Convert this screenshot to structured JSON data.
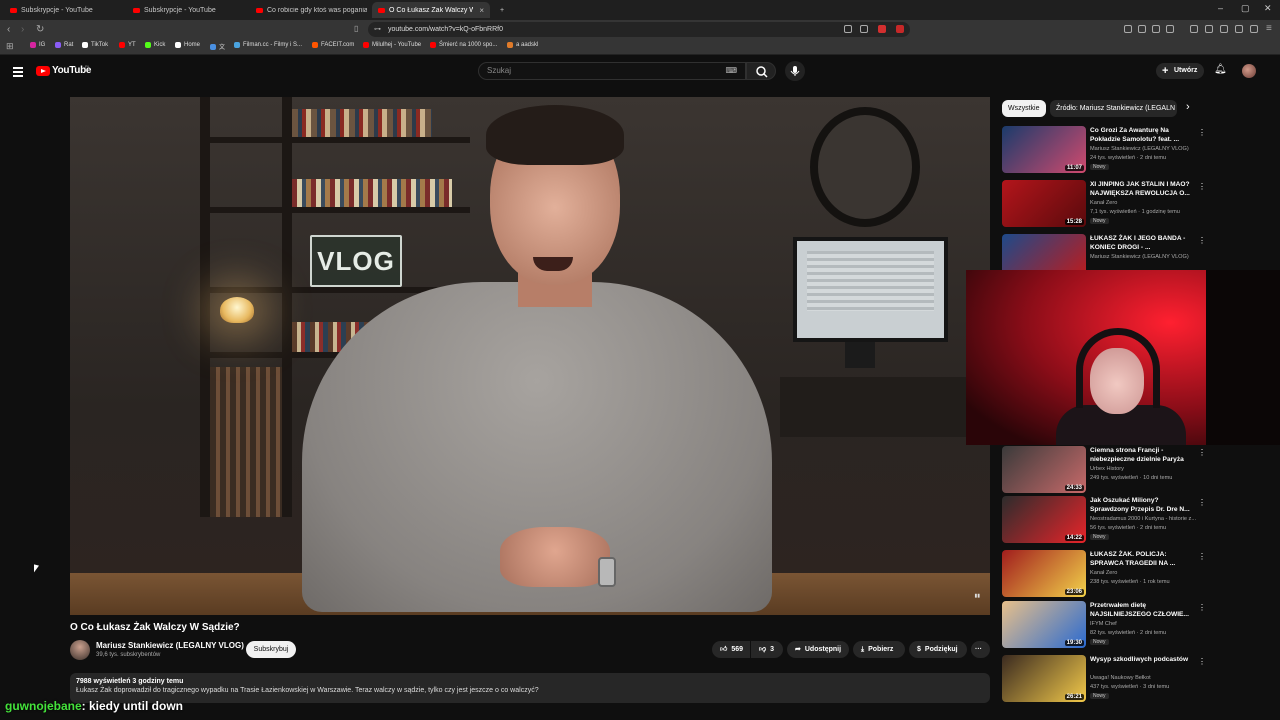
{
  "browser": {
    "tabs": [
      {
        "label": "Subskrypcje - YouTube"
      },
      {
        "label": "Subskrypcje - YouTube"
      },
      {
        "label": "Co robicie gdy ktoś was pogania świ..."
      },
      {
        "label": "O Co Łukasz Żak Walczy W S..."
      }
    ],
    "new_tab": "+",
    "url": "youtube.com/watch?v=kQ-oFbnRRf0",
    "bookmarks": [
      {
        "label": "IG",
        "color": "#d6249f"
      },
      {
        "label": "Rat",
        "color": "#8a5cf6"
      },
      {
        "label": "TikTok",
        "color": "#ffffff"
      },
      {
        "label": "YT",
        "color": "#ff0000"
      },
      {
        "label": "Kick",
        "color": "#53fc18"
      },
      {
        "label": "Home",
        "color": "#ffffff"
      },
      {
        "label": "文",
        "color": "#4a90e2"
      },
      {
        "label": "Filman.cc - Filmy i S...",
        "color": "#4aa3df"
      },
      {
        "label": "FACEIT.com",
        "color": "#ff5500"
      },
      {
        "label": "Milulhej - YouTube",
        "color": "#ff0000"
      },
      {
        "label": "Śmierć na 1000 spo...",
        "color": "#ff0000"
      },
      {
        "label": "a aadskl",
        "color": "#e07b2a"
      }
    ]
  },
  "yt": {
    "logo": "YouTube",
    "logo_region": "PL",
    "search_placeholder": "Szukaj",
    "create_label": "Utwórz"
  },
  "video": {
    "title": "O Co Łukasz Żak Walczy W Sądzie?",
    "neon_sign": "VLOG",
    "channel": "Mariusz Stankiewicz (LEGALNY VLOG)",
    "subs": "39,6 tys. subskrybentów",
    "subscribe": "Subskrybuj",
    "likes": "569",
    "dislikes": "3",
    "share": "Udostępnij",
    "download": "Pobierz",
    "thanks": "Podziękuj",
    "more": "···",
    "views_time": "7988 wyświetleń  3 godziny temu",
    "description": "Łukasz Żak doprowadził do tragicznego wypadku na Trasie Łazienkowskiej w Warszawie. Teraz walczy w sądzie, tylko czy jest jeszcze o co walczyć?"
  },
  "chips": [
    {
      "label": "Wszystkie"
    },
    {
      "label": "Źródło: Mariusz Stankiewicz (LEGALN"
    }
  ],
  "recommendations": [
    {
      "title": "Co Grozi Za Awanturę Na Pokładzie Samolotu? feat. ...",
      "channel": "Mariusz Stankiewicz (LEGALNY VLOG)",
      "stats": "24 tys. wyświetleń · 2 dni temu",
      "badge": "Nowy",
      "duration": "11:07",
      "thumb": [
        "#1a3b6b",
        "#d14a6e"
      ]
    },
    {
      "title": "XI JINPING JAK STALIN I MAO? NAJWIĘKSZA REWOLUCJA O...",
      "channel": "Kanał Zero",
      "stats": "7,1 tys. wyświetleń · 1 godzinę temu",
      "badge": "Nowy",
      "duration": "15:28",
      "thumb": [
        "#b3151b",
        "#5a0a0c"
      ]
    },
    {
      "title": "ŁUKASZ ŻAK I JEGO BANDA - KONIEC DROGI - ...",
      "channel": "Mariusz Stankiewicz (LEGALNY VLOG)",
      "stats": "",
      "badge": "",
      "duration": "",
      "thumb": [
        "#1d4a8a",
        "#c21a1a"
      ]
    },
    {
      "title": "Ciemna strona Francji - niebezpieczne dzielnie Paryża",
      "channel": "Urbex History",
      "stats": "249 tys. wyświetleń · 10 dni temu",
      "badge": "",
      "duration": "24:33",
      "thumb": [
        "#3a3a3a",
        "#c86a6a"
      ]
    },
    {
      "title": "Jak Oszukać Miliony? Sprawdzony Przepis Dr. Dre N...",
      "channel": "Neostradamus 2000 i Kurtyna - historie z...",
      "stats": "56 tys. wyświetleń · 2 dni temu",
      "badge": "Nowy",
      "duration": "14:22",
      "thumb": [
        "#2c2c2c",
        "#e8242a"
      ]
    },
    {
      "title": "ŁUKASZ ŻAK. POLICJA: SPRAWCA TRAGEDII NA ...",
      "channel": "Kanał Zero",
      "stats": "238 tys. wyświetleń · 1 rok temu",
      "badge": "",
      "duration": "23:06",
      "thumb": [
        "#a11d1d",
        "#f2d24a"
      ]
    },
    {
      "title": "Przetrwałem dietę NAJSILNIEJSZEGO CZŁOWIE...",
      "channel": "IFYM Chef",
      "stats": "82 tys. wyświetleń · 2 dni temu",
      "badge": "Nowy",
      "duration": "19:30",
      "thumb": [
        "#e8c08a",
        "#2a6ad0"
      ]
    },
    {
      "title": "Wysyp szkodliwych podcastów",
      "channel": "Uwaga! Naukowy Bełkot",
      "stats": "437 tys. wyświetleń · 3 dni temu",
      "badge": "Nowy",
      "duration": "26:21",
      "thumb": [
        "#3a2a20",
        "#f2c94a"
      ]
    }
  ],
  "chat": {
    "nick": "guwnojebane",
    "message": ": kiedy until down"
  }
}
